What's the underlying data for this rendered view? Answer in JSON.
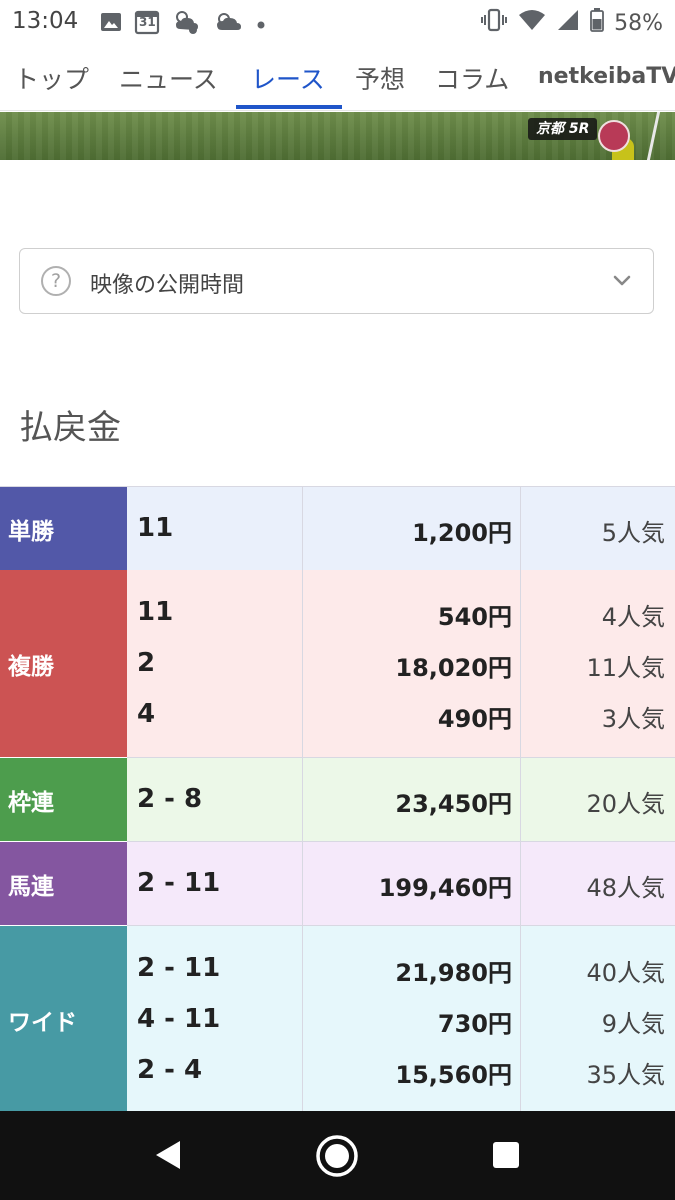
{
  "status_bar": {
    "time": "13:04",
    "battery": "58%",
    "calendar_day": "31"
  },
  "nav": {
    "tabs": [
      {
        "label": "トップ"
      },
      {
        "label": "ニュース"
      },
      {
        "label": "レース",
        "active": true
      },
      {
        "label": "予想"
      },
      {
        "label": "コラム"
      },
      {
        "label": "netkeibaTV"
      }
    ]
  },
  "video": {
    "badge": "京都 5R"
  },
  "disclosure": {
    "label": "映像の公開時間"
  },
  "payout": {
    "heading": "払戻金",
    "rows": [
      {
        "type": "単勝",
        "color": "#5258a8",
        "bg": "#eaf0fb",
        "entries": [
          {
            "num": "11",
            "pay": "1,200円",
            "pop": "5人気"
          }
        ]
      },
      {
        "type": "複勝",
        "color": "#cc5353",
        "bg": "#fdeaea",
        "entries": [
          {
            "num": "11",
            "pay": "540円",
            "pop": "4人気"
          },
          {
            "num": "2",
            "pay": "18,020円",
            "pop": "11人気"
          },
          {
            "num": "4",
            "pay": "490円",
            "pop": "3人気"
          }
        ]
      },
      {
        "type": "枠連",
        "color": "#4d9d4d",
        "bg": "#ecf8e8",
        "entries": [
          {
            "num": "2 - 8",
            "pay": "23,450円",
            "pop": "20人気"
          }
        ]
      },
      {
        "type": "馬連",
        "color": "#8456a0",
        "bg": "#f5e9fa",
        "entries": [
          {
            "num": "2 - 11",
            "pay": "199,460円",
            "pop": "48人気"
          }
        ]
      },
      {
        "type": "ワイド",
        "color": "#479aa4",
        "bg": "#e6f7fb",
        "entries": [
          {
            "num": "2 - 11",
            "pay": "21,980円",
            "pop": "40人気"
          },
          {
            "num": "4 - 11",
            "pay": "730円",
            "pop": "9人気"
          },
          {
            "num": "2 - 4",
            "pay": "15,560円",
            "pop": "35人気"
          }
        ]
      }
    ]
  }
}
